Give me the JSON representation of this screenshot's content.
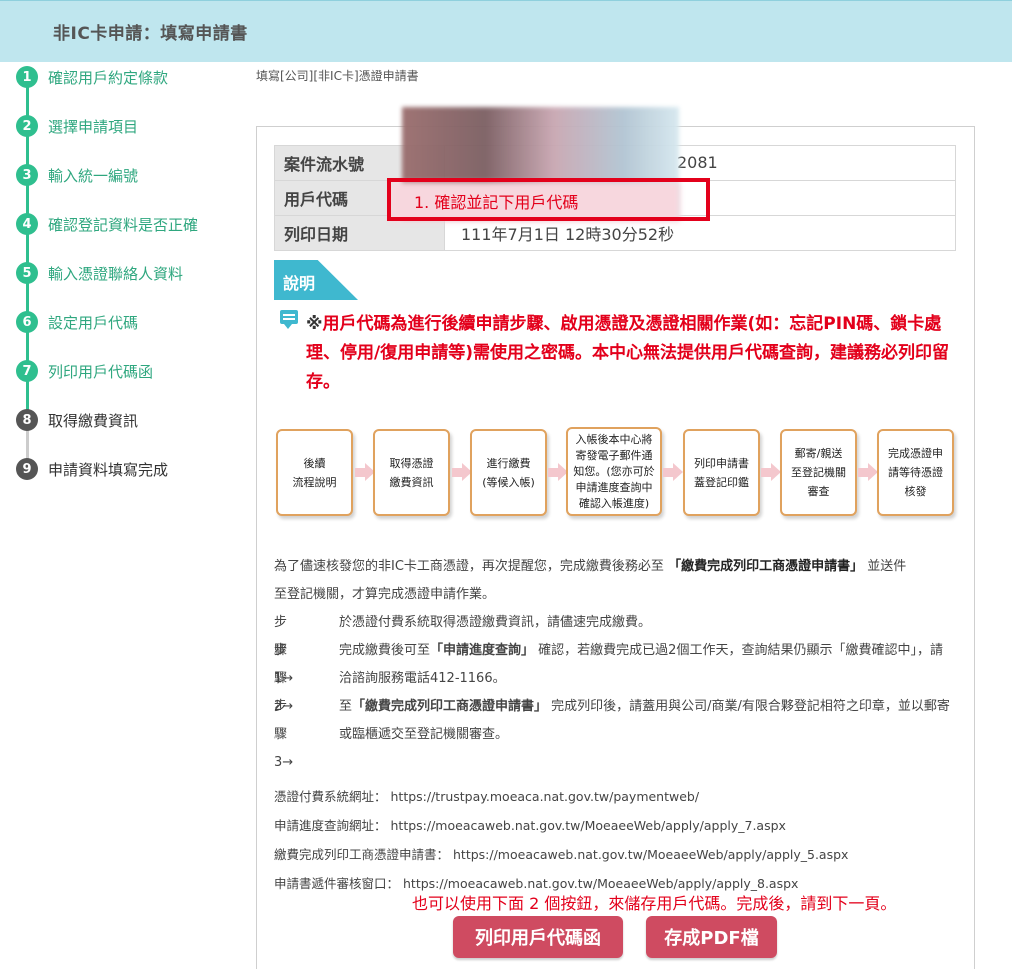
{
  "header": {
    "title": "非IC卡申請：填寫申請書"
  },
  "steps": [
    {
      "num": "1",
      "label": "確認用戶約定條款"
    },
    {
      "num": "2",
      "label": "選擇申請項目"
    },
    {
      "num": "3",
      "label": "輸入統一編號"
    },
    {
      "num": "4",
      "label": "確認登記資料是否正確"
    },
    {
      "num": "5",
      "label": "輸入憑證聯絡人資料"
    },
    {
      "num": "6",
      "label": "設定用戶代碼"
    },
    {
      "num": "7",
      "label": "列印用戶代碼函"
    },
    {
      "num": "8",
      "label": "取得繳費資訊"
    },
    {
      "num": "9",
      "label": "申請資料填寫完成"
    }
  ],
  "breadcrumb": "填寫[公司][非IC卡]憑證申請書",
  "info_table": {
    "rows": [
      {
        "key": "案件流水號",
        "value": "2081"
      },
      {
        "key": "用戶代碼",
        "value": ""
      },
      {
        "key": "列印日期",
        "value": "111年7月1日 12時30分52秒"
      }
    ]
  },
  "annotation": "1. 確認並記下用戶代碼",
  "explain_tag": "說明",
  "notice": {
    "prefix": "※",
    "text": "用戶代碼為進行後續申請步驟、啟用憑證及憑證相關作業(如：忘記PIN碼、鎖卡處理、停用/復用申請等)需使用之密碼。本中心無法提供用戶代碼查詢，建議務必列印留存。"
  },
  "flow": [
    {
      "line1": "後續",
      "line2": "流程說明"
    },
    {
      "line1": "取得憑證",
      "line2": "繳費資訊"
    },
    {
      "line1": "進行繳費",
      "line2": "(等候入帳)"
    },
    {
      "line1": "入帳後本中心將寄發電子郵件通知您。(您亦可於申請進度查詢中確認入帳進度)",
      "line2": ""
    },
    {
      "line1": "列印申請書",
      "line2": "蓋登記印鑑"
    },
    {
      "line1": "郵寄/親送",
      "line2": "至登記機關審查"
    },
    {
      "line1": "完成憑證申",
      "line2": "請等待憑證核發"
    }
  ],
  "intro": {
    "part1": "為了儘速核發您的非IC卡工商憑證，再次提醒您，完成繳費後務必至",
    "bold": "「繳費完成列印工商憑證申請書」",
    "part2": "並送件",
    "line2": "至登記機關，才算完成憑證申請作業。"
  },
  "procedure": [
    {
      "label": "步驟 1→",
      "text": "於憑證付費系統取得憑證繳費資訊，請儘速完成繳費。"
    },
    {
      "label": "步驟 2→",
      "text_a": "完成繳費後可至",
      "bold": "「申請進度查詢」",
      "text_b": "確認，若繳費完成已過2個工作天，查詢結果仍顯示「繳費確認中」，請洽諮詢服務電話412-1166。"
    },
    {
      "label": "步驟 3→",
      "text_a": "至",
      "bold": "「繳費完成列印工商憑證申請書」",
      "text_b": "完成列印後，請蓋用與公司/商業/有限合夥登記相符之印章，並以郵寄或臨櫃遞交至登記機關審查。"
    }
  ],
  "urls": [
    {
      "label": "憑證付費系統網址：",
      "url": "https://trustpay.moeaca.nat.gov.tw/paymentweb/"
    },
    {
      "label": "申請進度查詢網址：",
      "url": "https://moeacaweb.nat.gov.tw/MoeaeeWeb/apply/apply_7.aspx"
    },
    {
      "label": "繳費完成列印工商憑證申請書：",
      "url": "https://moeacaweb.nat.gov.tw/MoeaeeWeb/apply/apply_5.aspx"
    },
    {
      "label": "申請書遞件審核窗口：",
      "url": "https://moeacaweb.nat.gov.tw/MoeaeeWeb/apply/apply_8.aspx"
    }
  ],
  "hint": "也可以使用下面 2 個按鈕，來儲存用戶代碼。完成後，請到下一頁。",
  "buttons": {
    "print": "列印用戶代碼函",
    "pdf": "存成PDF檔"
  }
}
